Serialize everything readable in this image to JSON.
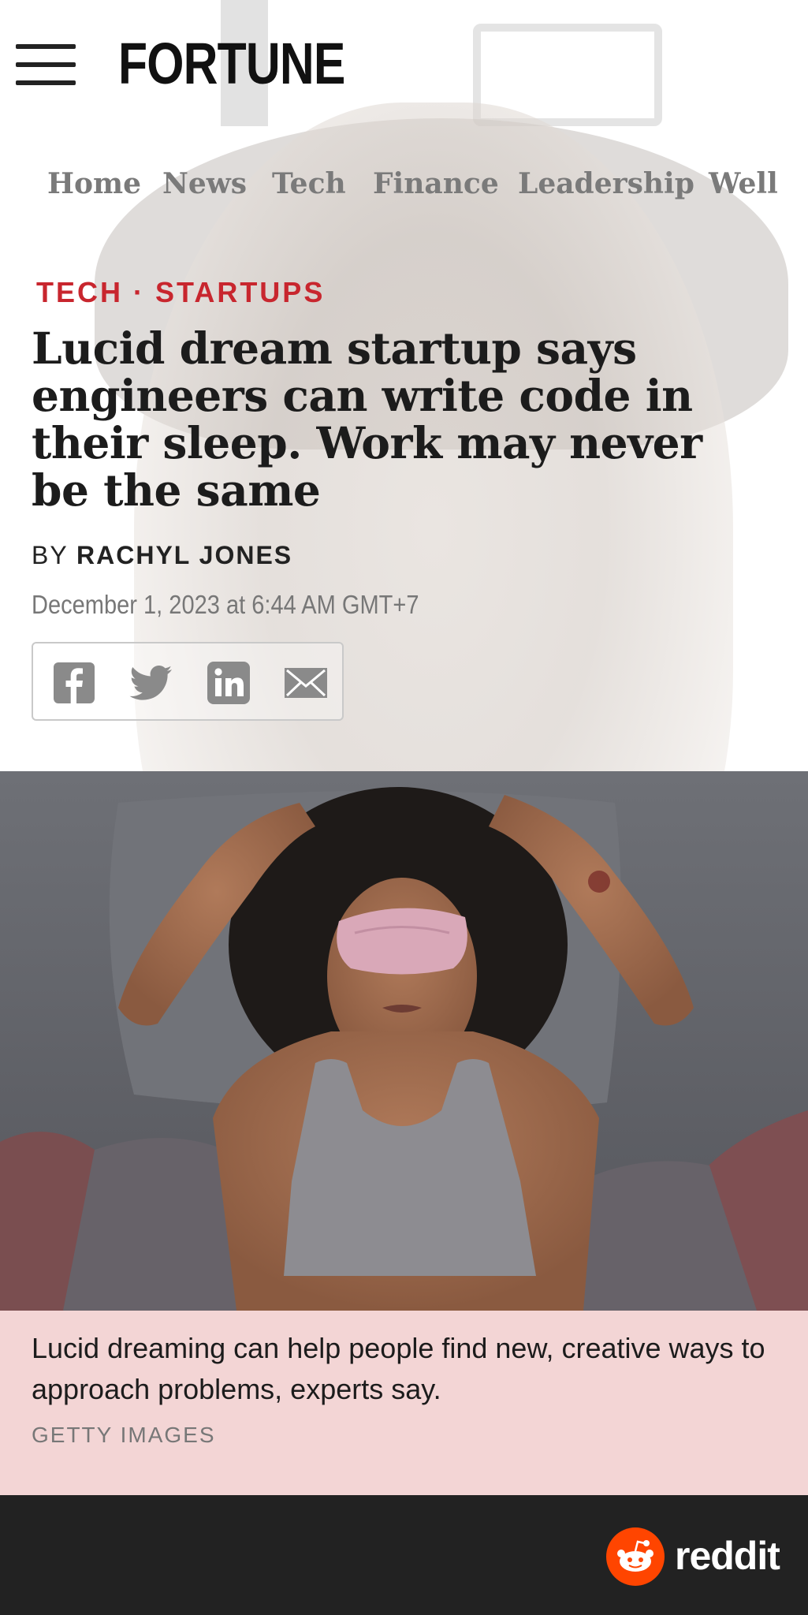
{
  "site": {
    "logo": "FORTUNE"
  },
  "nav": {
    "items": [
      "Home",
      "News",
      "Tech",
      "Finance",
      "Leadership",
      "Well"
    ]
  },
  "article": {
    "kicker": "TECH · STARTUPS",
    "headline": "Lucid dream startup says engineers can write code in their sleep. Work may never be the same",
    "byline_prefix": "BY",
    "author": "RACHYL JONES",
    "date": "December 1, 2023 at 6:44 AM GMT+7"
  },
  "share": {
    "icons": [
      "facebook-icon",
      "twitter-icon",
      "linkedin-icon",
      "email-icon"
    ]
  },
  "image": {
    "caption": "Lucid dreaming can help people find new, creative ways to approach problems, experts say.",
    "credit": "GETTY IMAGES"
  },
  "footer": {
    "brand": "reddit",
    "brand_color": "#ff4500"
  },
  "colors": {
    "kicker": "#c8262e",
    "caption_bg": "#f3d5d5",
    "footer_bg": "#222222"
  }
}
